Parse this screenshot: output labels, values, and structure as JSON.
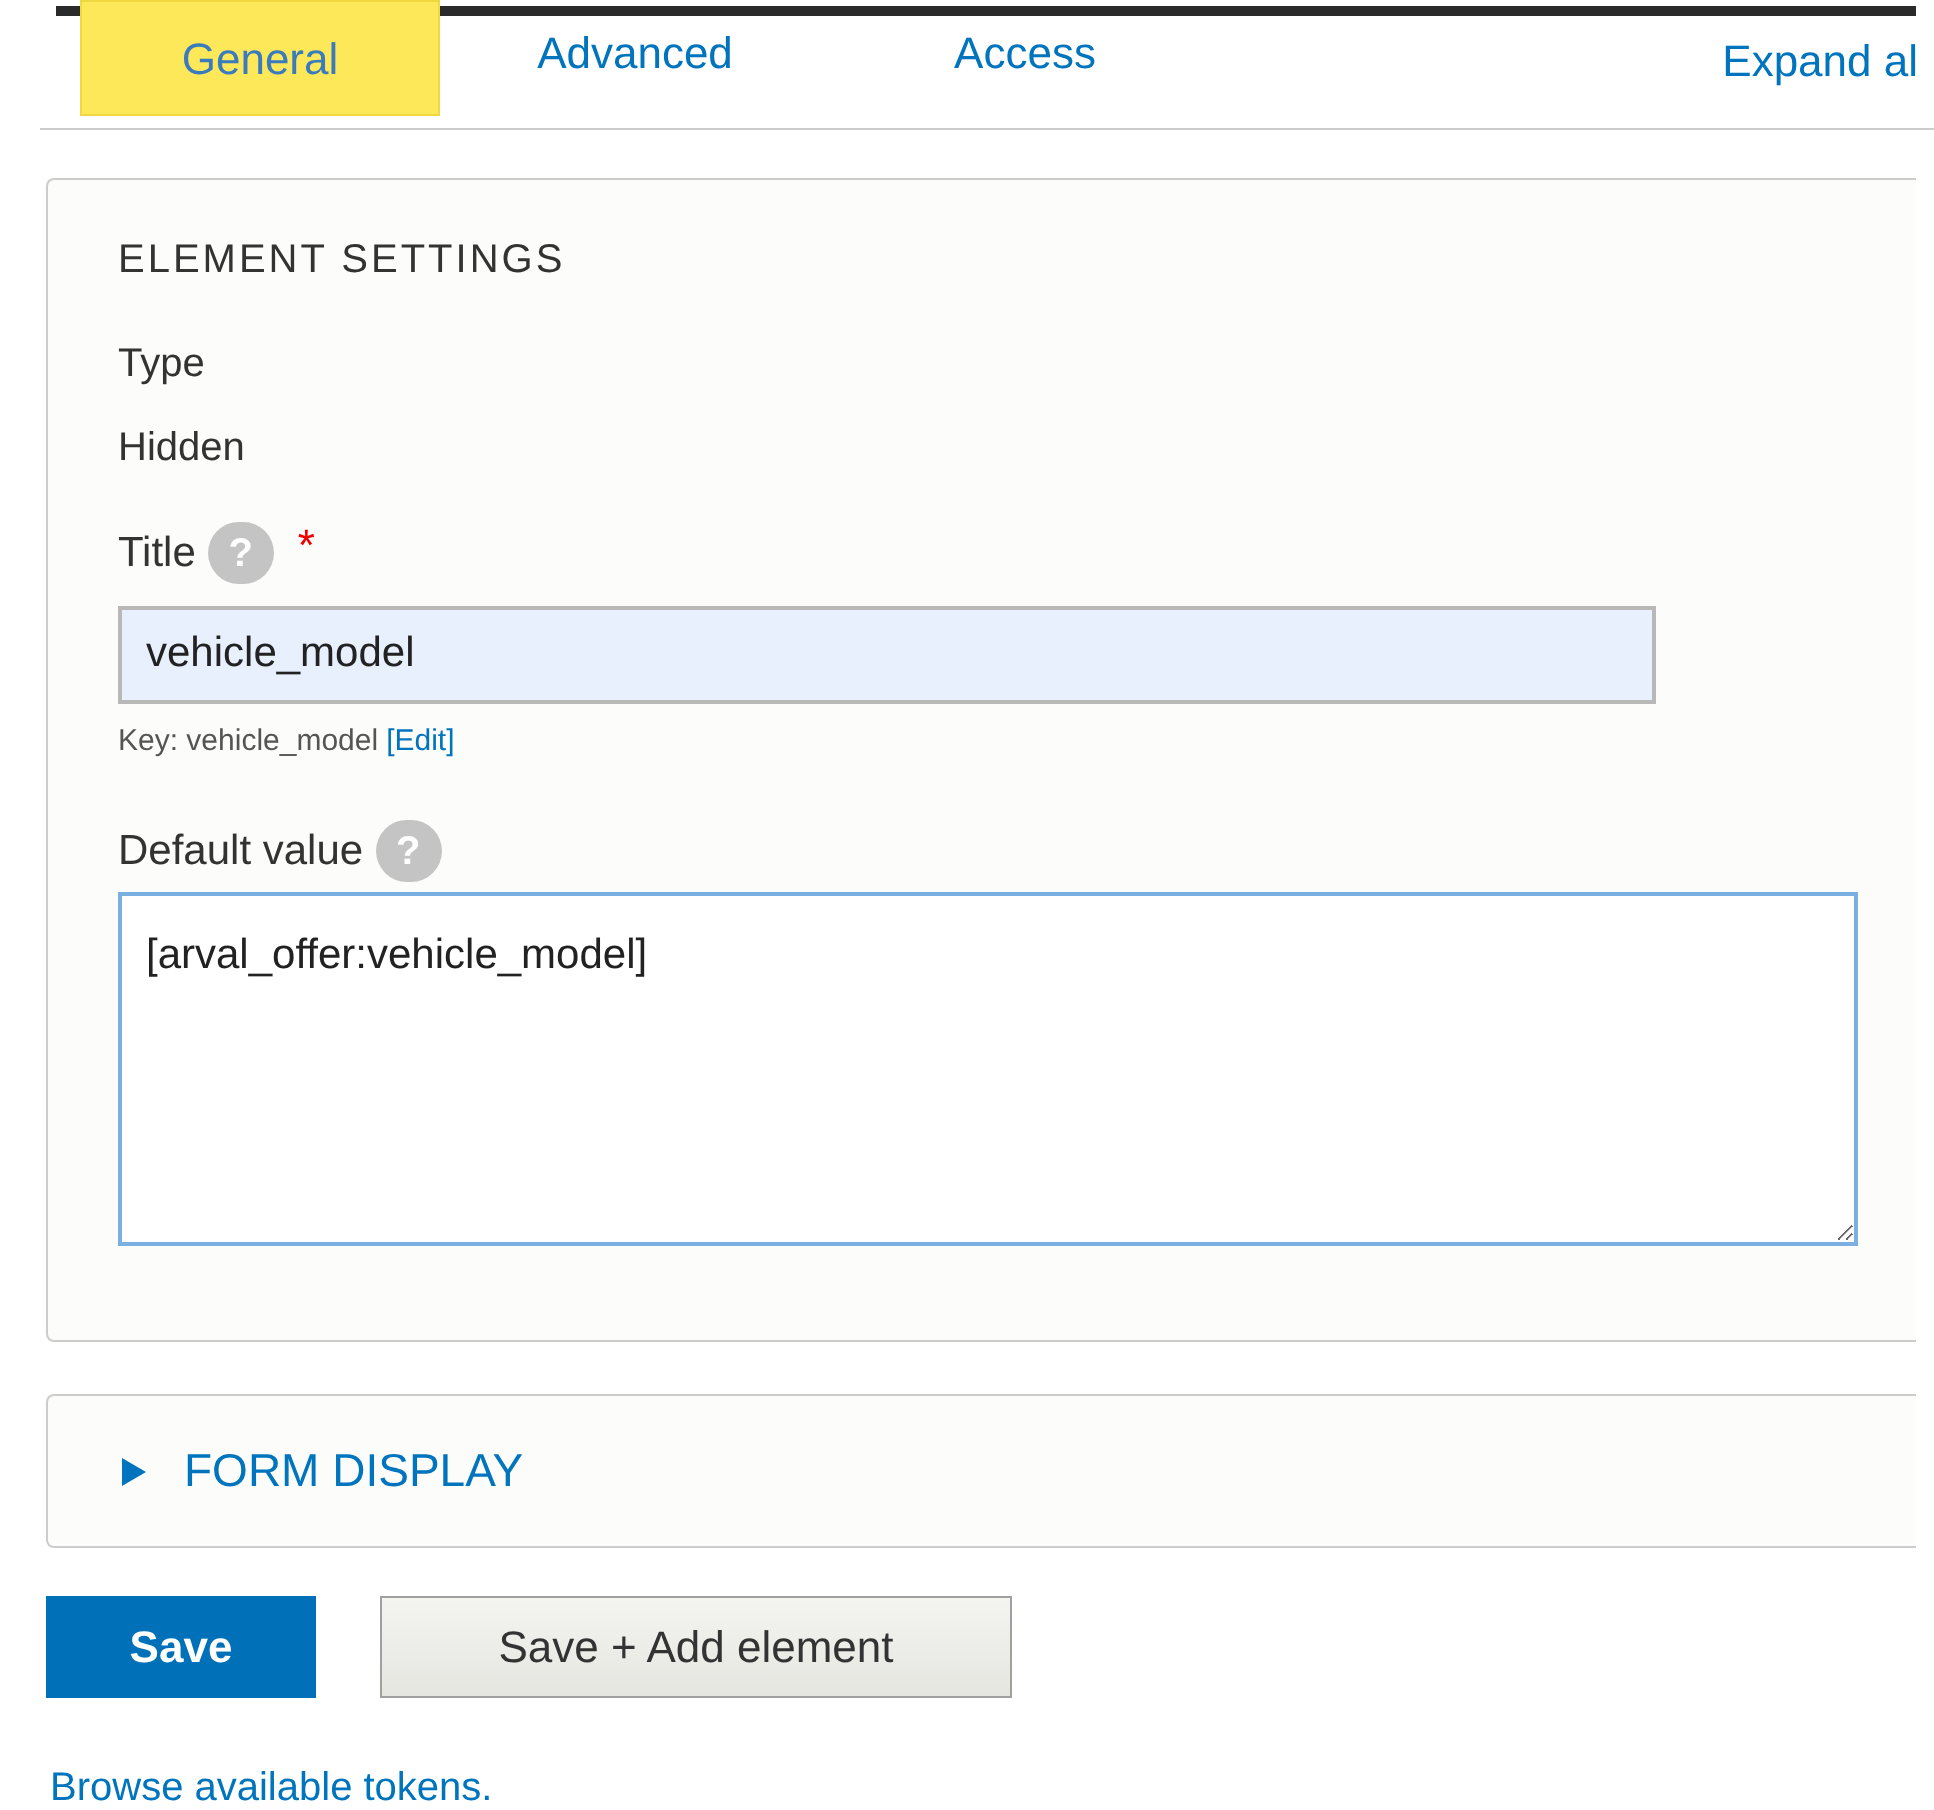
{
  "tabs": [
    {
      "label": "General",
      "selected": true
    },
    {
      "label": "Advanced",
      "selected": false
    },
    {
      "label": "Access",
      "selected": false
    }
  ],
  "expand_link": "Expand al",
  "element_settings": {
    "legend": "ELEMENT SETTINGS",
    "type_label": "Type",
    "type_value": "Hidden",
    "title_label": "Title",
    "title_help": "?",
    "required_mark": "*",
    "title_value": "vehicle_model",
    "key_text": "Key: vehicle_model",
    "key_edit_link": "[Edit]",
    "default_value_label": "Default value",
    "default_value_help": "?",
    "default_value": "[arval_offer:vehicle_model]"
  },
  "form_display": {
    "label": "FORM DISPLAY",
    "expanded": false
  },
  "buttons": [
    {
      "label": "Save",
      "kind": "primary"
    },
    {
      "label": "Save + Add element",
      "kind": "secondary"
    }
  ],
  "tokens_link": "Browse available tokens."
}
